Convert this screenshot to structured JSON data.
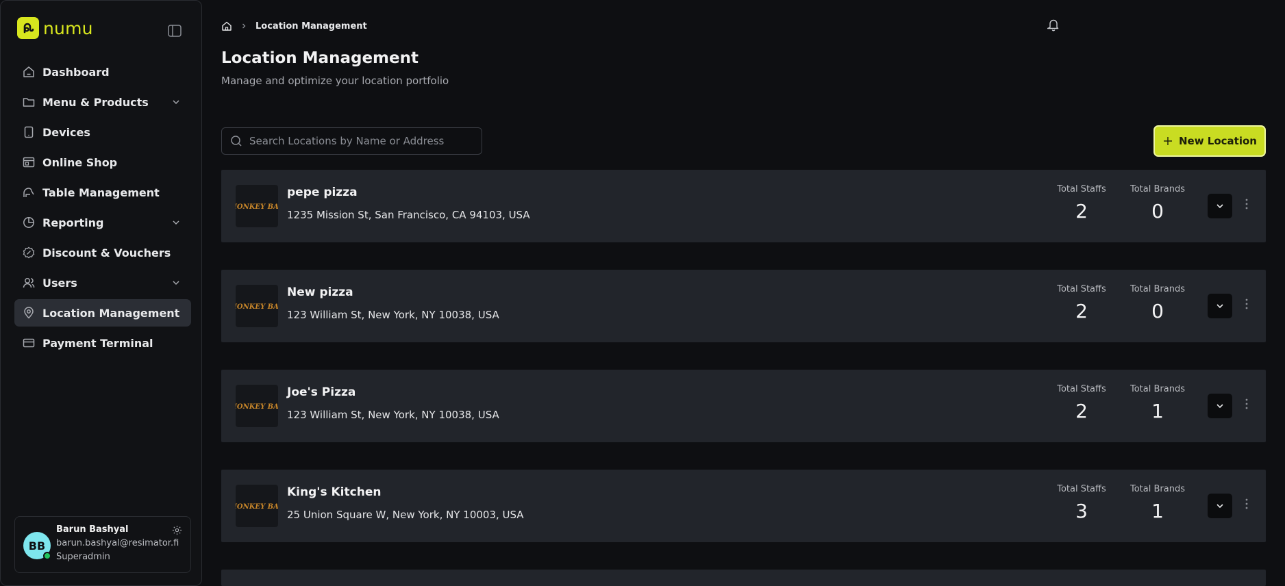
{
  "app": {
    "name": "numu",
    "accent": "#d8e61e"
  },
  "sidebar": {
    "items": [
      {
        "label": "Dashboard",
        "icon": "home-icon",
        "expandable": false,
        "active": false
      },
      {
        "label": "Menu & Products",
        "icon": "folder-icon",
        "expandable": true,
        "active": false
      },
      {
        "label": "Devices",
        "icon": "tablet-icon",
        "expandable": false,
        "active": false
      },
      {
        "label": "Online Shop",
        "icon": "store-icon",
        "expandable": false,
        "active": false
      },
      {
        "label": "Table Management",
        "icon": "table-icon",
        "expandable": false,
        "active": false
      },
      {
        "label": "Reporting",
        "icon": "pie-chart-icon",
        "expandable": true,
        "active": false
      },
      {
        "label": "Discount & Vouchers",
        "icon": "discount-icon",
        "expandable": false,
        "active": false
      },
      {
        "label": "Users",
        "icon": "users-icon",
        "expandable": true,
        "active": false
      },
      {
        "label": "Location Management",
        "icon": "map-pin-icon",
        "expandable": false,
        "active": true
      },
      {
        "label": "Payment Terminal",
        "icon": "credit-card-icon",
        "expandable": false,
        "active": false
      }
    ]
  },
  "user": {
    "initials": "BB",
    "name": "Barun Bashyal",
    "email": "barun.bashyal@resimator.fi",
    "role": "Superadmin"
  },
  "breadcrumb": {
    "current": "Location Management"
  },
  "page": {
    "title": "Location Management",
    "subtitle": "Manage and optimize your location portfolio"
  },
  "search": {
    "placeholder": "Search Locations by Name or Address",
    "value": ""
  },
  "new_button": {
    "label": "New Location"
  },
  "stats_labels": {
    "staffs": "Total Staffs",
    "brands": "Total Brands"
  },
  "locations": [
    {
      "name": "pepe pizza",
      "address": "1235 Mission St, San Francisco, CA 94103, USA",
      "staffs": "2",
      "brands": "0",
      "logo_text": "MONKEY BAR"
    },
    {
      "name": "New pizza",
      "address": "123 William St, New York, NY 10038, USA",
      "staffs": "2",
      "brands": "0",
      "logo_text": "MONKEY BAR"
    },
    {
      "name": "Joe's Pizza",
      "address": "123 William St, New York, NY 10038, USA",
      "staffs": "2",
      "brands": "1",
      "logo_text": "MONKEY BAR"
    },
    {
      "name": "King's Kitchen",
      "address": "25 Union Square W, New York, NY 10003, USA",
      "staffs": "3",
      "brands": "1",
      "logo_text": "MONKEY BAR"
    }
  ]
}
